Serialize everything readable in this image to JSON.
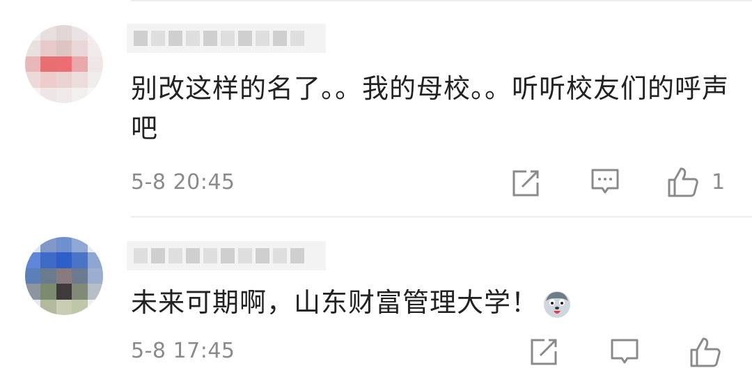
{
  "comments": [
    {
      "text": "别改这样的名了。。我的母校。。听听校友们的呼声吧",
      "time": "5-8 20:45",
      "likes": "1",
      "icons": {
        "share": "share-icon",
        "reply": "comment-icon",
        "like": "thumbs-up-icon"
      }
    },
    {
      "text": "未来可期啊，山东财富管理大学！",
      "emoji": "husky-emoji",
      "time": "5-8 17:45",
      "icons": {
        "share": "share-icon",
        "reply": "comment-icon",
        "like": "thumbs-up-icon"
      }
    }
  ],
  "colors": {
    "text": "#222222",
    "meta": "#8a8a8a",
    "divider": "#ececec"
  }
}
